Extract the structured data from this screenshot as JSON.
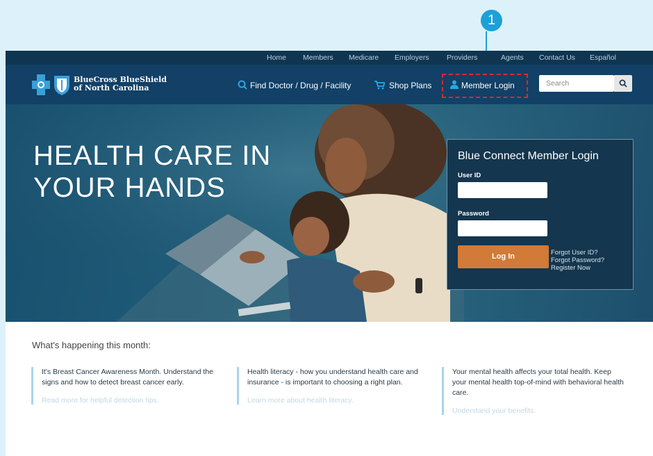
{
  "callout": {
    "number": "1"
  },
  "top_nav": {
    "items": [
      "Home",
      "Members",
      "Medicare",
      "Employers",
      "Providers",
      "Agents",
      "Contact Us",
      "Español"
    ]
  },
  "header": {
    "brand_line1": "BlueCross BlueShield",
    "brand_line2": "of North Carolina",
    "find_doctor": "Find Doctor / Drug / Facility",
    "shop_plans": "Shop Plans",
    "member_login": "Member Login",
    "search_placeholder": "Search"
  },
  "hero": {
    "title_line1": "HEALTH CARE IN",
    "title_line2": "YOUR HANDS"
  },
  "login": {
    "title": "Blue Connect Member Login",
    "user_id_label": "User ID",
    "password_label": "Password",
    "button": "Log In",
    "forgot_user": "Forgot User ID?",
    "forgot_password": "Forgot Password?",
    "register": "Register Now"
  },
  "month": {
    "title": "What's happening this month:",
    "articles": [
      {
        "text": "It's Breast Cancer Awareness Month. Understand the signs and how to detect breast cancer early.",
        "link": "Read more for helpful detection tips."
      },
      {
        "text": "Health literacy - how you understand health care and insurance - is important to choosing a right plan.",
        "link": "Learn more about health literacy."
      },
      {
        "text": "Your mental health affects your total health. Keep your mental health top-of-mind with behavioral health care.",
        "link": "Understand your benefits."
      }
    ]
  },
  "colors": {
    "background": "#ddf1fa",
    "top_nav": "#0f3551",
    "header": "#124066",
    "highlight": "#e0262f",
    "callout": "#1ba1d8",
    "login_button": "#d27a37",
    "article_rule": "#a8d4ea"
  },
  "icons": [
    "bcbs-cross-logo-icon",
    "bcbs-shield-logo-icon",
    "search-icon",
    "cart-icon",
    "person-icon",
    "magnifier-icon",
    "arrow-down-icon"
  ]
}
